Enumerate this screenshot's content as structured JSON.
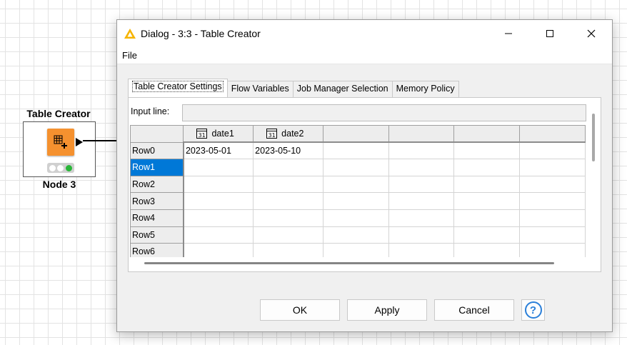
{
  "workflow": {
    "node": {
      "title": "Table Creator",
      "label": "Node 3",
      "color": "#f5912f",
      "icon": "table-grid-plus-icon",
      "status_light": "green"
    }
  },
  "dialog": {
    "title": "Dialog - 3:3 - Table Creator",
    "title_icon": "warning-triangle-icon",
    "menu": {
      "file": "File"
    },
    "tabs": [
      {
        "label": "Table Creator Settings",
        "active": true
      },
      {
        "label": "Flow Variables",
        "active": false
      },
      {
        "label": "Job Manager Selection",
        "active": false
      },
      {
        "label": "Memory Policy",
        "active": false
      }
    ],
    "input_line": {
      "label": "Input line:",
      "value": ""
    },
    "table": {
      "columns": [
        {
          "name": "date1",
          "type_icon": "calendar-31-icon"
        },
        {
          "name": "date2",
          "type_icon": "calendar-31-icon"
        },
        {
          "name": ""
        },
        {
          "name": ""
        },
        {
          "name": ""
        },
        {
          "name": ""
        }
      ],
      "rows": [
        {
          "header": "Row0",
          "cells": [
            "2023-05-01",
            "2023-05-10",
            "",
            "",
            "",
            ""
          ]
        },
        {
          "header": "Row1",
          "cells": [
            "",
            "",
            "",
            "",
            "",
            ""
          ],
          "selected": true
        },
        {
          "header": "Row2",
          "cells": [
            "",
            "",
            "",
            "",
            "",
            ""
          ]
        },
        {
          "header": "Row3",
          "cells": [
            "",
            "",
            "",
            "",
            "",
            ""
          ]
        },
        {
          "header": "Row4",
          "cells": [
            "",
            "",
            "",
            "",
            "",
            ""
          ]
        },
        {
          "header": "Row5",
          "cells": [
            "",
            "",
            "",
            "",
            "",
            ""
          ]
        },
        {
          "header": "Row6",
          "cells": [
            "",
            "",
            "",
            "",
            "",
            ""
          ]
        }
      ]
    },
    "buttons": {
      "ok": "OK",
      "apply": "Apply",
      "cancel": "Cancel",
      "help_glyph": "?"
    },
    "colors": {
      "selection": "#0078d7",
      "help": "#2a7fd9",
      "warning": "#f6b400"
    }
  }
}
